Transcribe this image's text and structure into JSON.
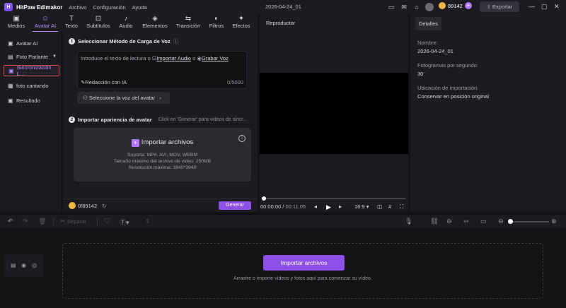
{
  "titlebar": {
    "app_name": "HitPaw Edimakor",
    "menus": [
      "Archivo",
      "Configuración",
      "Ayuda"
    ],
    "project_name": "2026-04-24_01",
    "credits": "89142",
    "export_label": "Exportar"
  },
  "tool_tabs": [
    {
      "label": "Medios",
      "icon": "media-icon"
    },
    {
      "label": "Avatar AI",
      "icon": "avatar-icon",
      "active": true
    },
    {
      "label": "Texto",
      "icon": "text-icon"
    },
    {
      "label": "Subtítulos",
      "icon": "subtitles-icon"
    },
    {
      "label": "Audio",
      "icon": "audio-icon"
    },
    {
      "label": "Elementos",
      "icon": "elements-icon"
    },
    {
      "label": "Transición",
      "icon": "transition-icon"
    },
    {
      "label": "Filtros",
      "icon": "filters-icon"
    },
    {
      "label": "Efectos",
      "icon": "effects-icon"
    }
  ],
  "left_nav": [
    {
      "label": "Avatar AI"
    },
    {
      "label": "Foto Parlante"
    },
    {
      "label": "Sincronización L..."
    },
    {
      "label": "foto cantando"
    },
    {
      "label": "Resultado"
    }
  ],
  "center": {
    "step1_label": "Seleccionar Método de Carga de Voz",
    "text_placeholder_prefix": "Introduce el texto de lectura o",
    "import_audio": "Importar Audio",
    "or": "o",
    "record_voice": "Grabar Voz",
    "ai_writing": "Redacción con IA",
    "char_counter": "0/5000",
    "select_voice": "Seleccione la voz del avatar",
    "step2_label": "Importar apariencia de avatar",
    "step2_hint": "Click en 'Generar' para videos de sincr...",
    "import_files": "Importar archivos",
    "support_line": "Soporta: MP4, AVI, MOV, WEBM",
    "size_line": "Tamaño máximo del archivo de video: 250MB",
    "resolution_line": "Resolución máxima: 3840*3840",
    "footer_credits": "0/89142",
    "generate_label": "Generar"
  },
  "player": {
    "title": "Reproductor",
    "time_current": "00:00:00",
    "time_total": "00:11:05",
    "aspect_ratio": "16:9",
    "progress": 0
  },
  "details": {
    "tab_label": "Detalles",
    "name_key": "Nombre:",
    "name_value": "2026-04-24_01",
    "fps_key": "Fotogramas por segundo:",
    "fps_value": "30",
    "location_key": "Ubicación de importación:",
    "location_value": "Conservar en posición original"
  },
  "timeline_toolbar": {
    "split_label": "Separar"
  },
  "timeline": {
    "import_button": "Importar archivos",
    "hint": "Arrastre o importe vídeos y fotos aquí para comenzar su vídeo."
  },
  "colors": {
    "accent": "#8e4fe8",
    "accent_text": "#b98bff",
    "active_border": "#e54848",
    "background": "#1c1c20"
  }
}
